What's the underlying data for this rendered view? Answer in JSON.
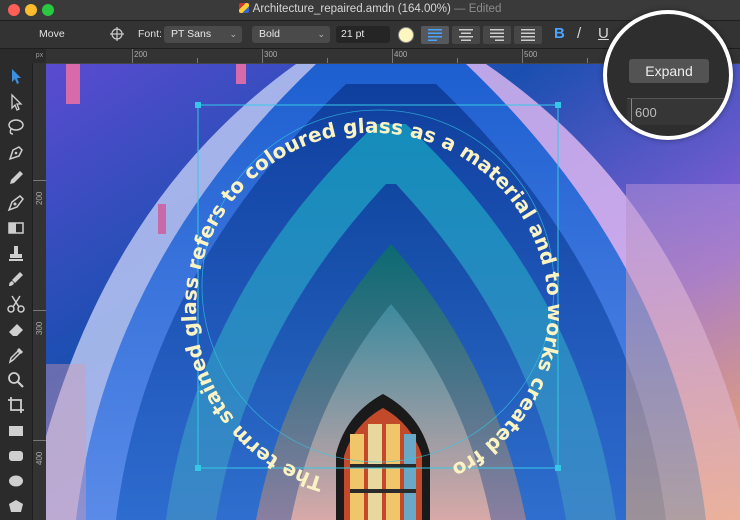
{
  "window": {
    "title": "Architecture_repaired.amdn (164.00%)",
    "edited": "— Edited"
  },
  "toolbar": {
    "tool_name": "Move",
    "font_label": "Font:",
    "font_family": "PT Sans",
    "font_style": "Bold",
    "font_size": "21 pt",
    "text_color": "#fdf6c0",
    "bold_label": "B",
    "italic_label": "/",
    "underline_label": "U"
  },
  "rulers": {
    "corner": "px",
    "top": [
      "200",
      "300",
      "400",
      "500"
    ],
    "left": [
      "200",
      "300",
      "400"
    ]
  },
  "tools": [
    "move-tool-icon",
    "node-tool-icon",
    "lasso-tool-icon",
    "pen-tool-icon",
    "pencil-tool-icon",
    "vector-brush-icon",
    "gradient-tool-icon",
    "stamp-tool-icon",
    "brush-tool-icon",
    "scissors-icon",
    "eraser-icon",
    "eyedropper-icon",
    "zoom-icon",
    "crop-icon",
    "rectangle-icon",
    "rounded-rectangle-icon",
    "ellipse-icon",
    "polygon-icon"
  ],
  "canvas": {
    "path_text": "The term stained glass refers to coloured glass as a material and to works created from it"
  },
  "callout": {
    "button_label": "Expand",
    "ruler_value": "600"
  }
}
